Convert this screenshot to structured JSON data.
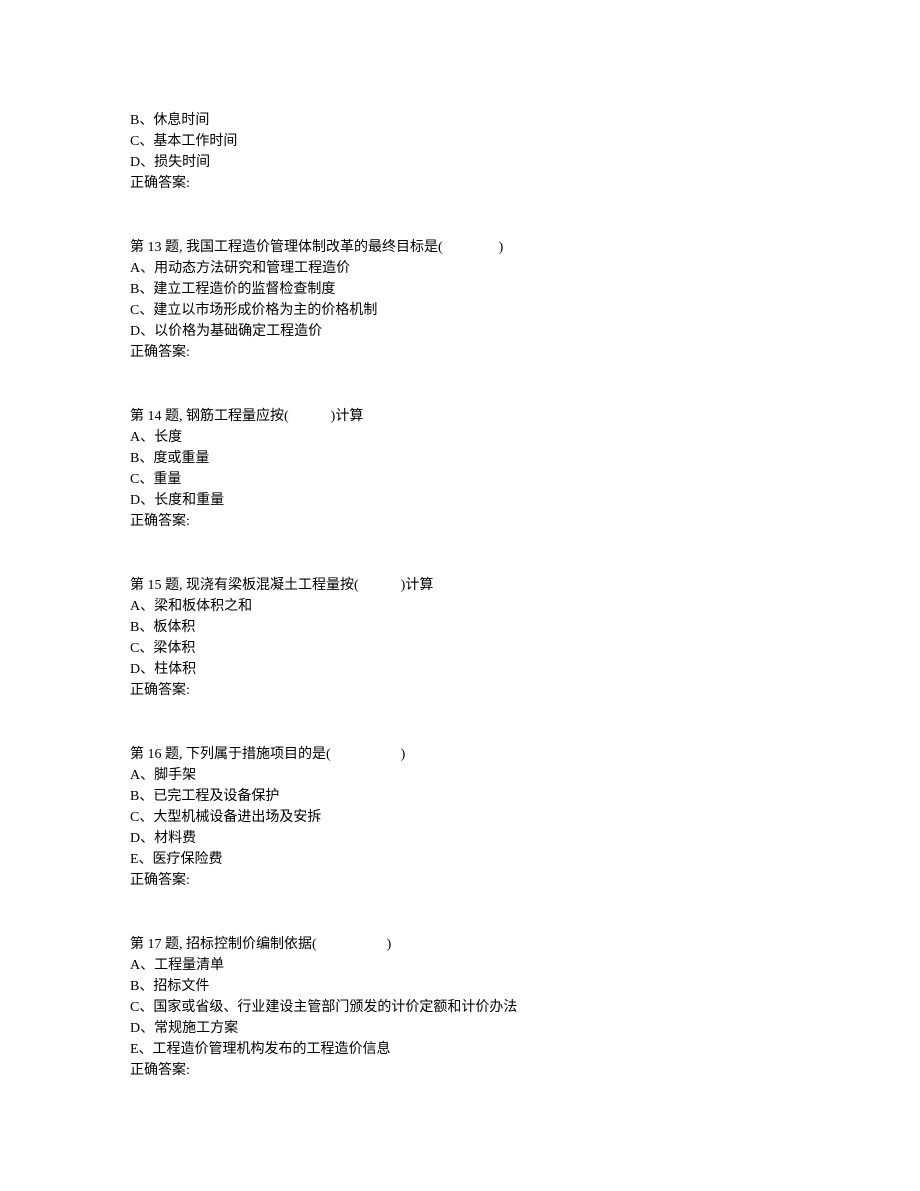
{
  "q12_partial": {
    "options": [
      "B、休息时间",
      "C、基本工作时间",
      "D、损失时间"
    ],
    "answer_label": "正确答案:"
  },
  "q13": {
    "text": "第 13 题, 我国工程造价管理体制改革的最终目标是(　　　　)",
    "options": [
      "A、用动态方法研究和管理工程造价",
      "B、建立工程造价的监督检查制度",
      "C、建立以市场形成价格为主的价格机制",
      "D、以价格为基础确定工程造价"
    ],
    "answer_label": "正确答案:"
  },
  "q14": {
    "text": "第 14 题, 钢筋工程量应按(　　　)计算",
    "options": [
      "A、长度",
      "B、度或重量",
      "C、重量",
      "D、长度和重量"
    ],
    "answer_label": "正确答案:"
  },
  "q15": {
    "text": "第 15 题, 现浇有梁板混凝土工程量按(　　　)计算",
    "options": [
      "A、梁和板体积之和",
      "B、板体积",
      "C、梁体积",
      "D、柱体积"
    ],
    "answer_label": "正确答案:"
  },
  "q16": {
    "text": "第 16 题, 下列属于措施项目的是(　　　　　)",
    "options": [
      "A、脚手架",
      "B、已完工程及设备保护",
      "C、大型机械设备进出场及安拆",
      "D、材料费",
      "E、医疗保险费"
    ],
    "answer_label": "正确答案:"
  },
  "q17": {
    "text": "第 17 题, 招标控制价编制依据(　　　　　)",
    "options": [
      "A、工程量清单",
      "B、招标文件",
      "C、国家或省级、行业建设主管部门颁发的计价定额和计价办法",
      "D、常规施工方案",
      "E、工程造价管理机构发布的工程造价信息"
    ],
    "answer_label": "正确答案:"
  }
}
